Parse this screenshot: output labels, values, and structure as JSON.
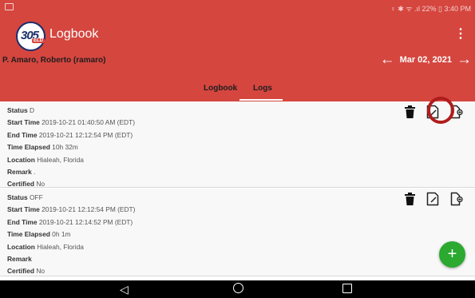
{
  "status_bar": {
    "right_text": "♀ ✱ ᯤ .ıl 22% ▯ 3:40 PM"
  },
  "app": {
    "logo_number": "305",
    "logo_badge": "ELD",
    "title": "Logbook",
    "menu_icon": "⋮"
  },
  "driver": {
    "name": "P. Amaro, Roberto (ramaro)"
  },
  "date_nav": {
    "prev_icon": "←",
    "date": "Mar 02, 2021",
    "next_icon": "→"
  },
  "tabs": [
    {
      "label": "Logbook",
      "selected": false
    },
    {
      "label": "Logs",
      "selected": true
    }
  ],
  "records": [
    {
      "status_label": "Status",
      "status": "D",
      "start_label": "Start Time",
      "start": "2019-10-21 01:40:50 AM (EDT)",
      "end_label": "End Time",
      "end": "2019-10-21 12:12:54 PM (EDT)",
      "elapsed_label": "Time Elapsed",
      "elapsed": "10h 32m",
      "location_label": "Location",
      "location": "Hialeah, Florida",
      "remark_label": "Remark",
      "remark": ".",
      "certified_label": "Certified",
      "certified": "No"
    },
    {
      "status_label": "Status",
      "status": "OFF",
      "start_label": "Start Time",
      "start": "2019-10-21 12:12:54 PM (EDT)",
      "end_label": "End Time",
      "end": "2019-10-21 12:14:52 PM (EDT)",
      "elapsed_label": "Time Elapsed",
      "elapsed": "0h 1m",
      "location_label": "Location",
      "location": "Hialeah, Florida",
      "remark_label": "Remark",
      "remark": "",
      "certified_label": "Certified",
      "certified": "No"
    }
  ],
  "fab": {
    "icon": "+"
  },
  "nav_bar": {
    "back_icon": "◁"
  },
  "colors": {
    "header_red": "#d5463f",
    "highlight_ring": "#b01c1c",
    "fab_green": "#2ba930"
  }
}
